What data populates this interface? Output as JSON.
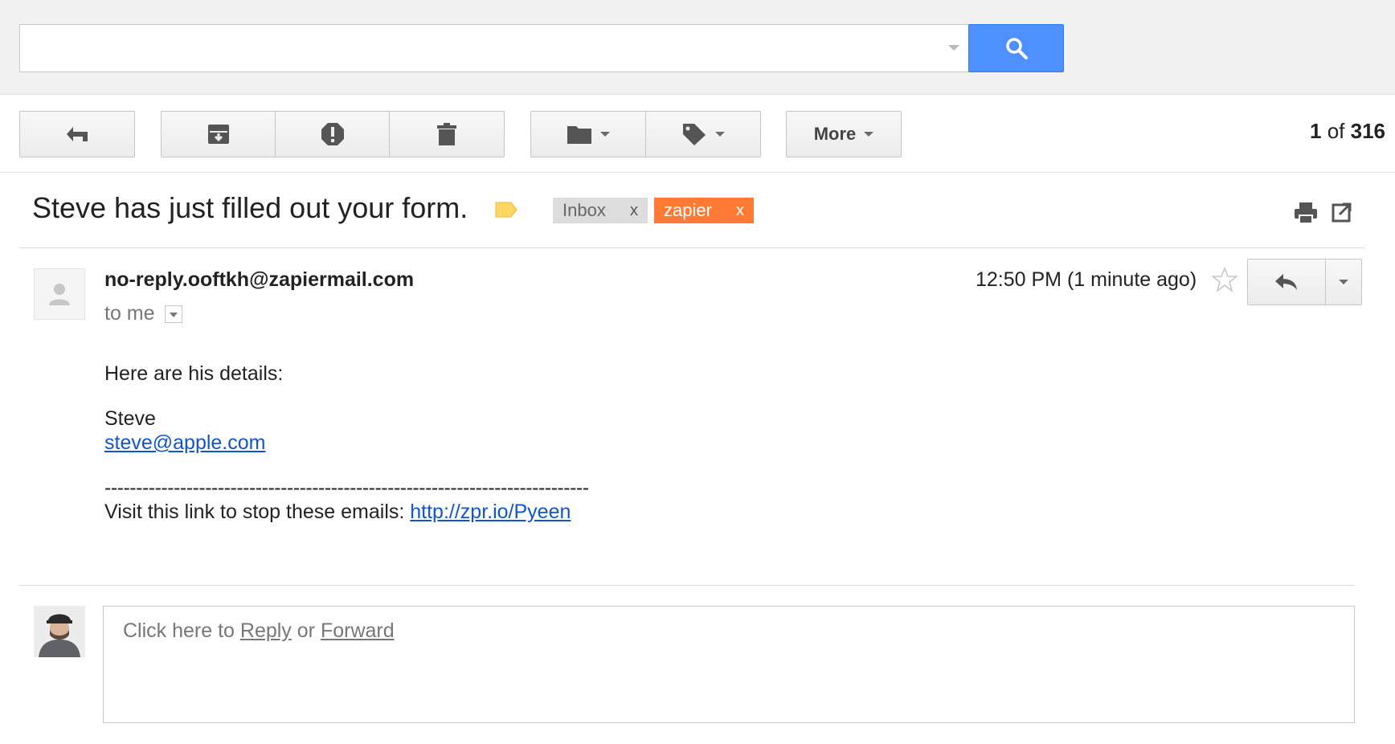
{
  "search": {
    "value": "",
    "button_icon": "search-icon"
  },
  "toolbar": {
    "back_icon": "back-arrow-icon",
    "archive_icon": "archive-icon",
    "spam_icon": "report-spam-icon",
    "delete_icon": "trash-icon",
    "move_icon": "folder-icon",
    "labels_icon": "label-icon",
    "more_label": "More"
  },
  "pager": {
    "current": "1",
    "of": "of",
    "total": "316"
  },
  "message": {
    "subject": "Steve has just filled out your form.",
    "labels": [
      {
        "name": "Inbox",
        "remove": "x",
        "color": "#dddddd"
      },
      {
        "name": "zapier",
        "remove": "x",
        "color": "#ff7a35"
      }
    ],
    "sender": "no-reply.ooftkh@zapiermail.com",
    "recipient": "to me",
    "timestamp": "12:50 PM (1 minute ago)",
    "body": {
      "intro": "Here are his details:",
      "name": "Steve",
      "email": "steve@apple.com",
      "separator": "-----------------------------------------------------------------------------",
      "unsubscribe_text": "Visit this link to stop these emails: ",
      "unsubscribe_link": "http://zpr.io/Pyeen"
    }
  },
  "reply": {
    "prompt_prefix": "Click here to ",
    "reply_link": "Reply",
    "or_text": " or ",
    "forward_link": "Forward"
  },
  "colors": {
    "search_button": "#4d90fe",
    "link": "#1155cc",
    "zapier_label": "#ff7a35",
    "important_marker": "#fcd663"
  }
}
